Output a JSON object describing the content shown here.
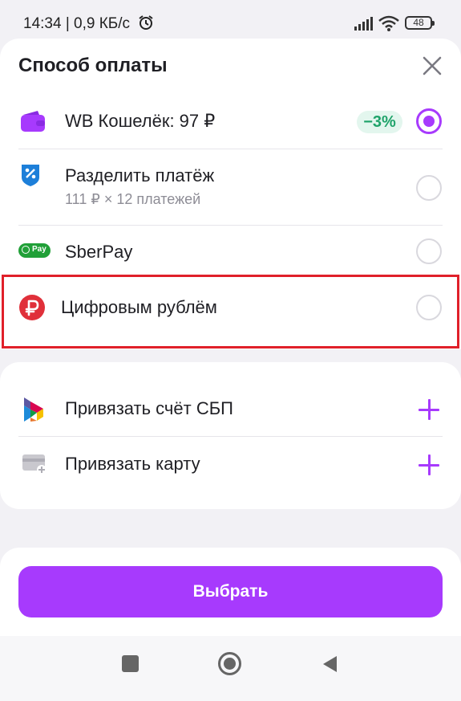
{
  "status_bar": {
    "time_and_speed": "14:34 | 0,9 КБ/с",
    "battery": "48"
  },
  "sheet": {
    "title": "Способ оплаты"
  },
  "payment_options": [
    {
      "label": "WB Кошелёк: 97 ₽",
      "badge": "−3%",
      "selected": true,
      "icon": "wallet-icon"
    },
    {
      "label": "Разделить платёж",
      "sublabel": "111 ₽ × 12 платежей",
      "selected": false,
      "icon": "split-payment-icon"
    },
    {
      "label": "SberPay",
      "icon_text": "Pay",
      "selected": false,
      "icon": "sberpay-icon"
    },
    {
      "label": "Цифровым рублём",
      "selected": false,
      "icon": "digital-ruble-icon"
    }
  ],
  "add_methods": [
    {
      "label": "Привязать счёт СБП",
      "icon": "sbp-icon"
    },
    {
      "label": "Привязать карту",
      "icon": "card-add-icon"
    }
  ],
  "actions": {
    "select_label": "Выбрать"
  },
  "colors": {
    "accent": "#a73afd",
    "badge_green": "#1fa36a",
    "highlight_red": "#e0202a"
  }
}
